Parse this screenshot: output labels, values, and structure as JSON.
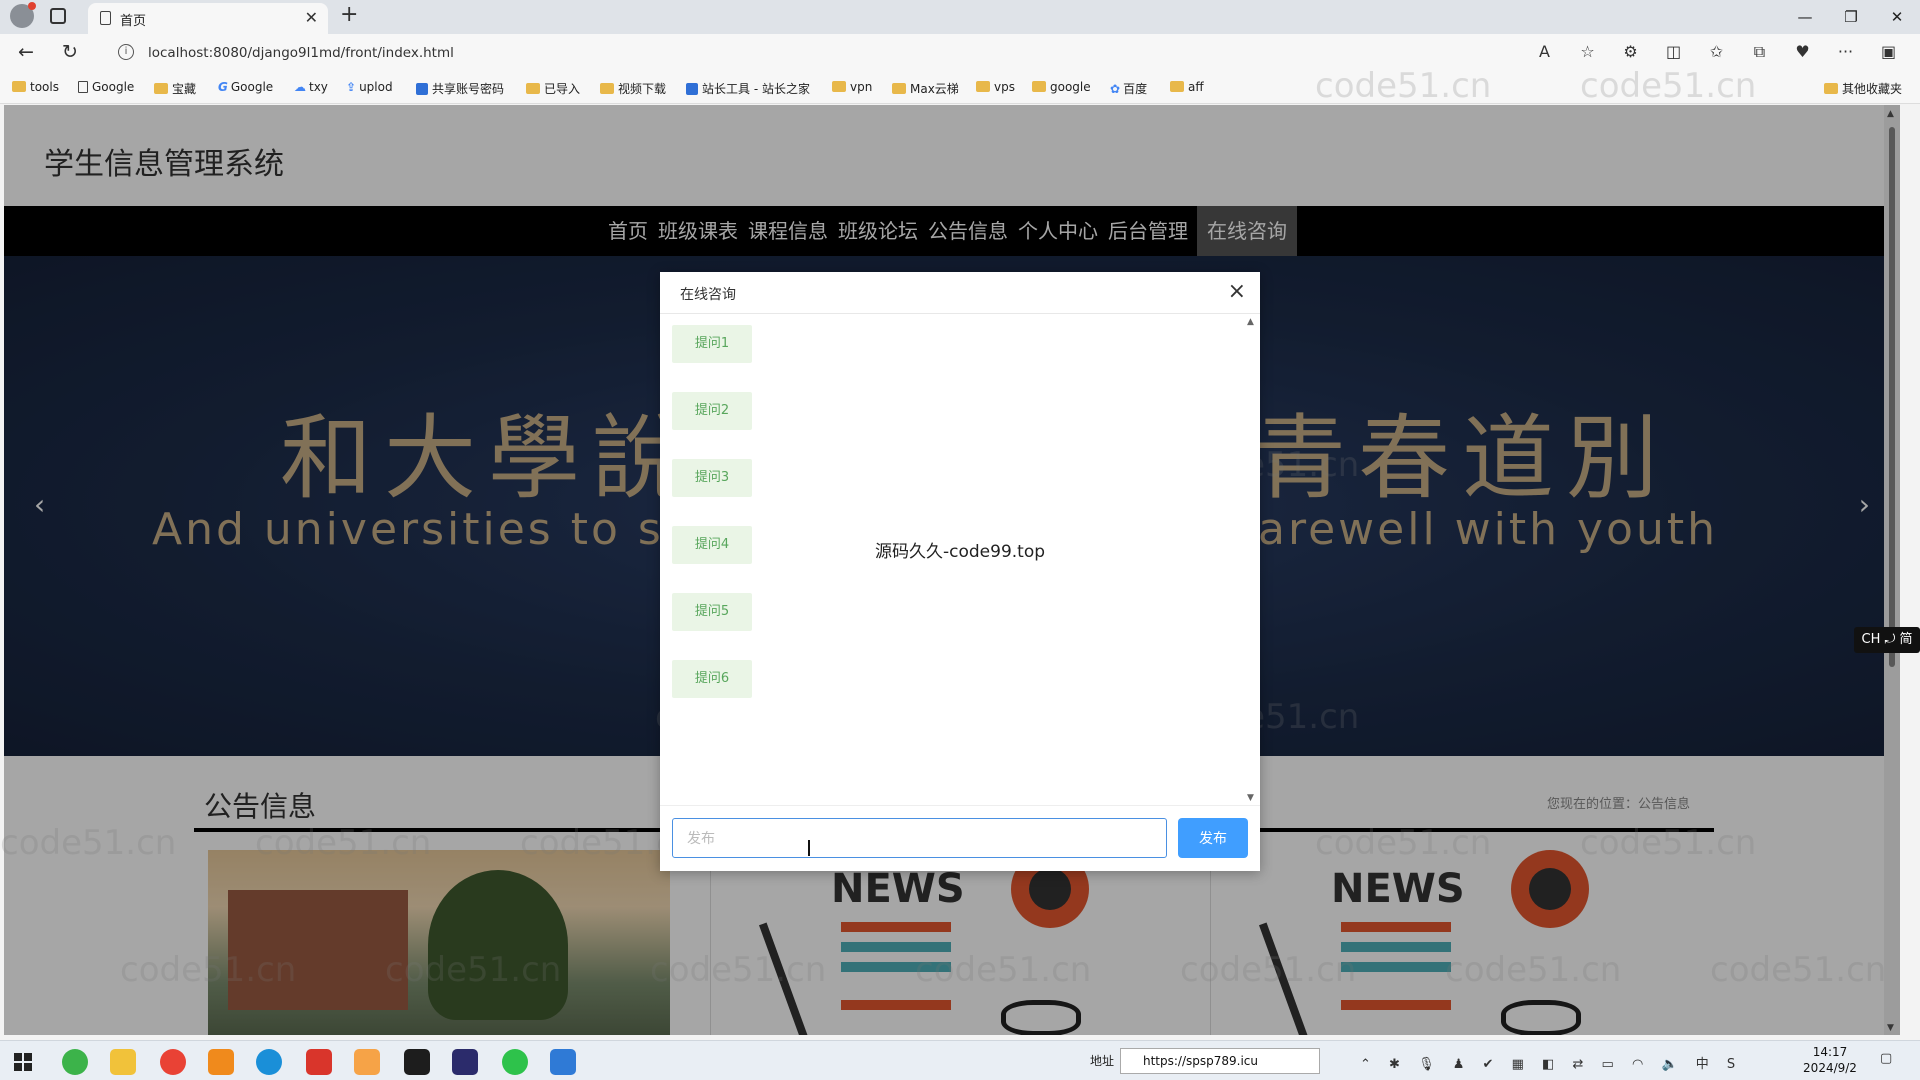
{
  "browser": {
    "tab_title": "首页",
    "url": "localhost:8080/django9l1md/front/index.html",
    "bookmarks": [
      "tools",
      "Google",
      "宝藏",
      "Google",
      "txy",
      "uplod",
      "共享账号密码",
      "已导入",
      "视频下载",
      "站长工具 - 站长之家",
      "vpn",
      "Max云梯",
      "vps",
      "google",
      "百度",
      "aff"
    ],
    "other_bookmarks": "其他收藏夹"
  },
  "site": {
    "title": "学生信息管理系统",
    "nav": [
      "首页",
      "班级课表",
      "课程信息",
      "班级论坛",
      "公告信息",
      "个人中心",
      "后台管理",
      "在线咨询"
    ],
    "active_nav": "在线咨询"
  },
  "banner": {
    "cn_left": "和大學說",
    "cn_right": "青春道別",
    "en_left": "And universities to s",
    "en_right": "arewell with youth",
    "prev": "‹",
    "next": "›"
  },
  "section": {
    "title": "公告信息",
    "breadcrumb": "您现在的位置：公告信息"
  },
  "modal": {
    "title": "在线咨询",
    "close": "×",
    "messages": [
      "提问1",
      "提问2",
      "提问3",
      "提问4",
      "提问5",
      "提问6"
    ],
    "center_text": "源码久久-code99.top",
    "input_placeholder": "发布",
    "send_label": "发布"
  },
  "watermark": "code51.cn",
  "ime_indicator": "CH ⤾ 简",
  "taskbar": {
    "address_label": "地址",
    "address_value": "https://spsp789.icu",
    "time": "14:17",
    "date": "2024/9/2",
    "ime": "中"
  },
  "colors": {
    "nav_bg": "#000000",
    "nav_active": "#555555",
    "banner_bg": "#1e2f4e",
    "banner_text": "#c7ae86",
    "bubble_bg": "#eaf5e6",
    "bubble_text": "#58a65c",
    "send_btn": "#409eff"
  }
}
